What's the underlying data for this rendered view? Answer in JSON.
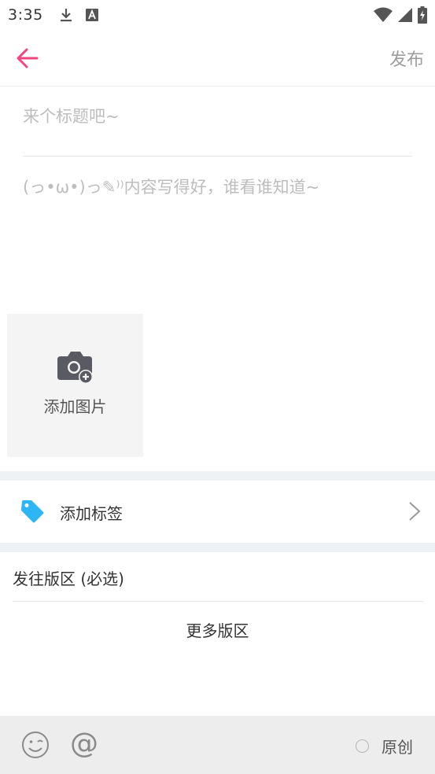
{
  "status_bar": {
    "time": "3:35",
    "icons": [
      "download-icon",
      "font-a-icon",
      "wifi-icon",
      "signal-icon",
      "battery-charging-icon"
    ]
  },
  "top_bar": {
    "back_icon": "back-arrow-icon",
    "publish_label": "发布",
    "accent_color": "#f0457e"
  },
  "editor": {
    "title_placeholder": "来个标题吧~",
    "content_placeholder": "(っ•ω•)っ✎⁾⁾内容写得好，谁看谁知道~"
  },
  "add_image": {
    "icon": "camera-add-icon",
    "label": "添加图片"
  },
  "tag_row": {
    "icon": "tag-icon",
    "label": "添加标签",
    "icon_color": "#2db5f5"
  },
  "board": {
    "heading": "发往版区 (必选)",
    "more_label": "更多版区"
  },
  "bottom_bar": {
    "emoji_icon": "emoji-icon",
    "mention_label": "@",
    "original_label": "原创"
  }
}
